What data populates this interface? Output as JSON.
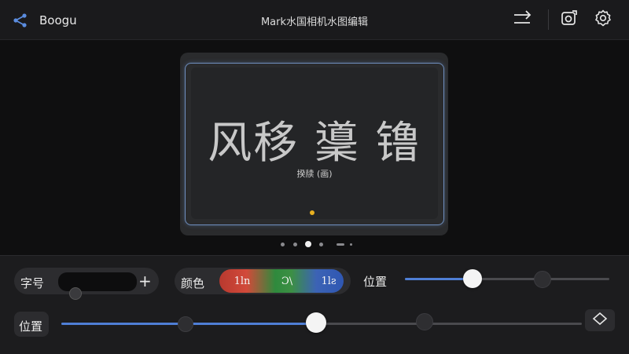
{
  "header": {
    "app_name": "Boogu",
    "title": "Mark水国相机水图编辑"
  },
  "icons": {
    "share": "share-icon",
    "redo": "redo-icon",
    "camera_edit": "camera-edit-icon",
    "settings": "gear-icon",
    "expand": "expand-icon"
  },
  "preview": {
    "watermark_text": "风移 䆃 镥",
    "watermark_caption": "揆牍 (画)"
  },
  "pager": {
    "count": 6,
    "active_index": 2
  },
  "controls": {
    "font_size_label": "字号",
    "font_size_value": "",
    "plus_label": "+",
    "color_label": "颜色",
    "swatches": [
      {
        "label": "1ln",
        "color": "#c8413a"
      },
      {
        "label": "Ɔ\\",
        "color": "#33903f"
      },
      {
        "label": "1lƨ",
        "color": "#3560b7"
      }
    ],
    "position_label_1": "位置",
    "position_slider_1": 0.33,
    "position_label_2": "位置",
    "position_slider_2": 0.49
  },
  "colors": {
    "accent": "#4f7fd6",
    "focus_dot": "#e8b020",
    "frame": "#6f8fbf"
  }
}
